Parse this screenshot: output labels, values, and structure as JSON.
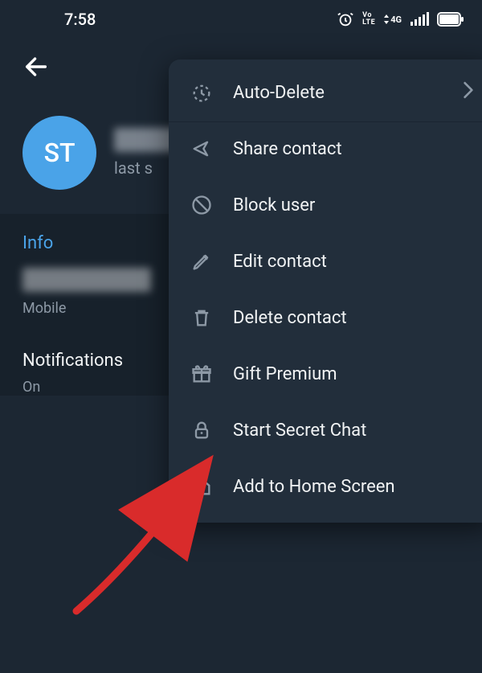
{
  "status": {
    "time": "7:58"
  },
  "profile": {
    "avatar_initials": "ST",
    "last_seen": "last s"
  },
  "info": {
    "section_title": "Info",
    "phone_type": "Mobile"
  },
  "notifications": {
    "label": "Notifications",
    "value": "On"
  },
  "menu": {
    "items": [
      {
        "label": "Auto-Delete"
      },
      {
        "label": "Share contact"
      },
      {
        "label": "Block user"
      },
      {
        "label": "Edit contact"
      },
      {
        "label": "Delete contact"
      },
      {
        "label": "Gift Premium"
      },
      {
        "label": "Start Secret Chat"
      },
      {
        "label": "Add to Home Screen"
      }
    ]
  }
}
